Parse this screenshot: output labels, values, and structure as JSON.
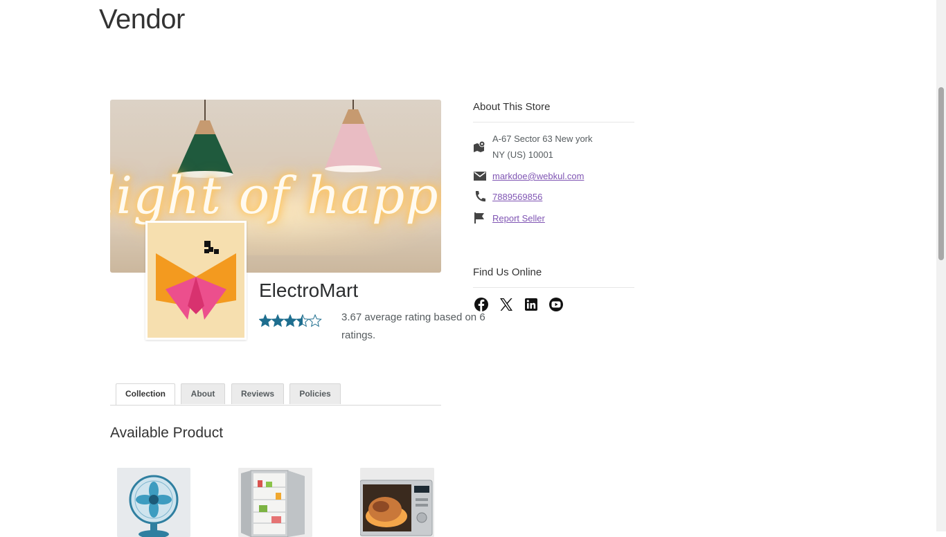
{
  "page": {
    "title": "Vendor"
  },
  "banner": {
    "script_text": "light of happines"
  },
  "store": {
    "name": "ElectroMart",
    "rating": 3.67,
    "rating_max": 5,
    "rating_text": "3.67 average rating based on 6 ratings."
  },
  "sidebar": {
    "about_title": "About This Store",
    "address_line1": "A-67 Sector 63 New york",
    "address_line2": "NY (US) 10001",
    "email": "markdoe@webkul.com",
    "phone": "7889569856",
    "report_label": "Report Seller",
    "find_title": "Find Us Online",
    "socials": [
      "facebook-icon",
      "x-twitter-icon",
      "linkedin-icon",
      "youtube-icon"
    ]
  },
  "tabs": [
    {
      "label": "Collection",
      "active": true
    },
    {
      "label": "About",
      "active": false
    },
    {
      "label": "Reviews",
      "active": false
    },
    {
      "label": "Policies",
      "active": false
    }
  ],
  "products_section": {
    "title": "Available Product",
    "items": [
      "table-fan",
      "refrigerator",
      "microwave-oven"
    ]
  },
  "colors": {
    "link": "#7f54b3",
    "star": "#1e6e8f",
    "logo_bg": "#f6dfaf"
  }
}
